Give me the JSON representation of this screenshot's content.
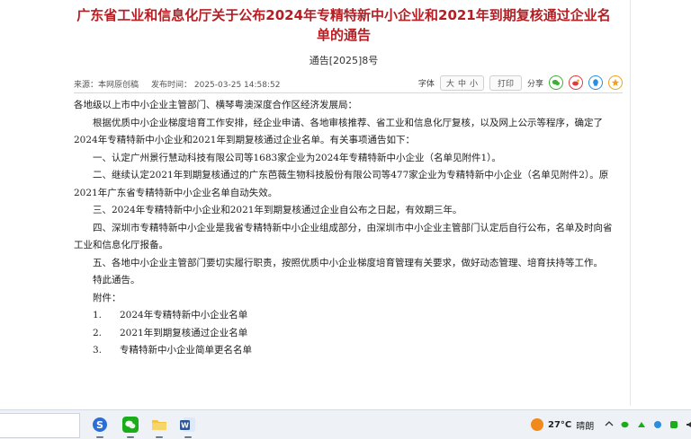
{
  "article": {
    "title": "广东省工业和信息化厅关于公布2024年专精特新中小企业和2021年到期复核通过企业名单的通告",
    "doc_number": "通告[2025]8号",
    "source": "来源：本网原创稿",
    "publish_time": "发布时间：  2025-03-25 14:58:52",
    "font_label": "字体",
    "font_sizes": [
      "大",
      "中",
      "小"
    ],
    "print_label": "打印",
    "share_label": "分享",
    "share_icons": [
      "wechat-icon",
      "weibo-icon",
      "qq-icon",
      "qzone-icon"
    ],
    "paragraphs": [
      {
        "text": "各地级以上市中小企业主管部门、横琴粤澳深度合作区经济发展局：",
        "indent": false
      },
      {
        "text": "根据优质中小企业梯度培育工作安排，经企业申请、各地审核推荐、省工业和信息化厅复核，以及网上公示等程序，确定了2024年专精特新中小企业和2021年到期复核通过企业名单。有关事项通告如下：",
        "indent": true
      },
      {
        "text": "一、认定广州景行慧动科技有限公司等1683家企业为2024年专精特新中小企业（名单见附件1）。",
        "indent": true
      },
      {
        "text": "二、继续认定2021年到期复核通过的广东芭薇生物科技股份有限公司等477家企业为专精特新中小企业（名单见附件2）。原2021年广东省专精特新中小企业名单自动失效。",
        "indent": true
      },
      {
        "text": "三、2024年专精特新中小企业和2021年到期复核通过企业自公布之日起，有效期三年。",
        "indent": true
      },
      {
        "text": "四、深圳市专精特新中小企业是我省专精特新中小企业组成部分，由深圳市中小企业主管部门认定后自行公布，名单及时向省工业和信息化厅报备。",
        "indent": true
      },
      {
        "text": "五、各地中小企业主管部门要切实履行职责，按照优质中小企业梯度培育管理有关要求，做好动态管理、培育扶持等工作。",
        "indent": true
      },
      {
        "text": "特此通告。",
        "indent": true
      },
      {
        "text": "附件：",
        "indent": true
      }
    ],
    "attachments": [
      {
        "num": "1.",
        "name": "2024年专精特新中小企业名单"
      },
      {
        "num": "2.",
        "name": "2021年到期复核通过企业名单"
      },
      {
        "num": "3.",
        "name": "专精特新中小企业简单更名名单"
      }
    ]
  },
  "taskbar": {
    "apps": [
      "sogou-icon",
      "wechat-app-icon",
      "file-explorer-icon",
      "word-icon"
    ],
    "weather_temp": "27°C",
    "weather_desc": "晴朗",
    "colors": {
      "title": "#b41f24",
      "sun": "#f08a1c"
    }
  }
}
